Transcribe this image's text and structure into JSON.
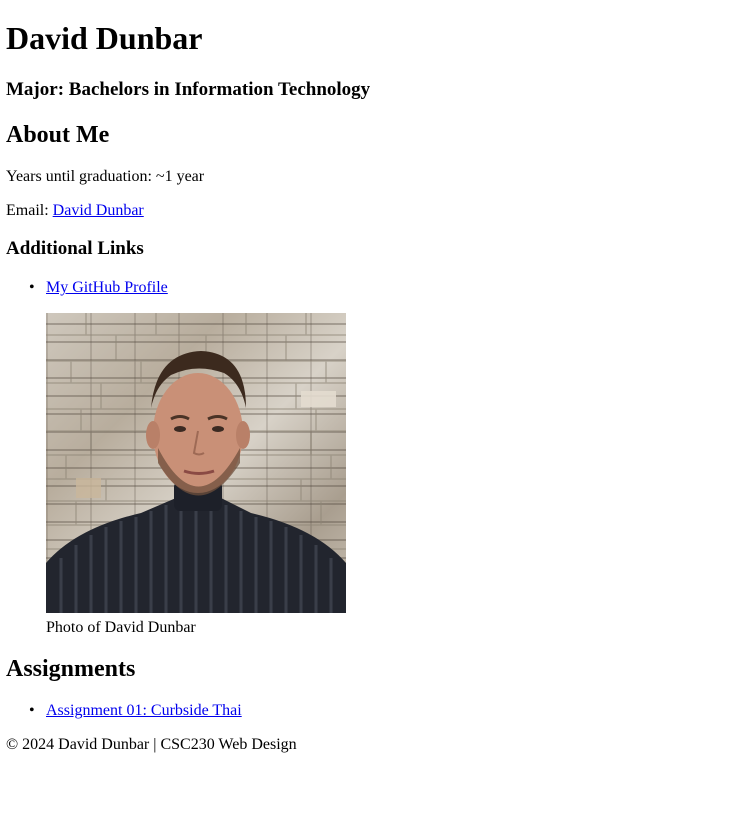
{
  "header": {
    "name": "David Dunbar",
    "major": "Major: Bachelors in Information Technology"
  },
  "about": {
    "heading": "About Me",
    "graduation": "Years until graduation: ~1 year",
    "email_label": "Email: ",
    "email_link": "David Dunbar"
  },
  "links": {
    "heading": "Additional Links",
    "items": [
      {
        "label": "My GitHub Profile"
      }
    ]
  },
  "photo": {
    "caption": "Photo of David Dunbar"
  },
  "assignments": {
    "heading": "Assignments",
    "items": [
      {
        "label": "Assignment 01: Curbside Thai"
      }
    ]
  },
  "footer": {
    "text": "© 2024 David Dunbar | CSC230 Web Design"
  }
}
